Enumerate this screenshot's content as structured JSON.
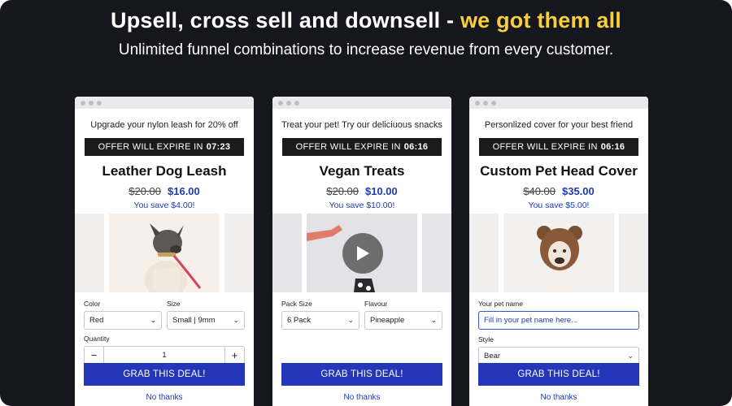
{
  "header": {
    "headline_main": "Upsell, cross sell and downsell - ",
    "headline_highlight": "we got them all",
    "subheadline": "Unlimited funnel combinations to increase revenue from every customer."
  },
  "colors": {
    "background": "#16161e",
    "highlight": "#f7cf3d",
    "cta": "#2337b8",
    "price_blue": "#1f3bb3"
  },
  "cards": [
    {
      "caption": "Upgrade your nylon leash for 20% off",
      "timer_label": "OFFER WILL EXPIRE IN",
      "timer_value": "07:23",
      "product": "Leather Dog Leash",
      "old_price": "$20.00",
      "new_price": "$16.00",
      "savings": "You save $4.00!",
      "image": "dog-with-leash",
      "field1_label": "Color",
      "field1_value": "Red",
      "field2_label": "Size",
      "field2_value": "Small | 9mm",
      "quantity_label": "Quantity",
      "quantity_minus": "−",
      "quantity_value": "1",
      "quantity_plus": "+",
      "cta": "GRAB THIS DEAL!",
      "decline": "No thanks"
    },
    {
      "caption": "Treat your pet! Try our deliciuous snacks",
      "timer_label": "OFFER WILL EXPIRE IN",
      "timer_value": "06:16",
      "product": "Vegan Treats",
      "old_price": "$20.00",
      "new_price": "$10.00",
      "savings": "You save $10.00!",
      "image": "video-with-play-icon",
      "field1_label": "Pack Size",
      "field1_value": "6 Pack",
      "field2_label": "Flavour",
      "field2_value": "Pineapple",
      "cta": "GRAB THIS DEAL!",
      "decline": "No thanks"
    },
    {
      "caption": "Personlized cover for your best friend",
      "timer_label": "OFFER WILL EXPIRE IN",
      "timer_value": "06:16",
      "product": "Custom Pet Head Cover",
      "old_price": "$40.00",
      "new_price": "$35.00",
      "savings": "You save $5.00!",
      "image": "dog-in-bear-hood",
      "pet_name_label": "Your pet name",
      "pet_name_placeholder": "Fill in your pet name here...",
      "style_label": "Style",
      "style_value": "Bear",
      "cta": "GRAB THIS DEAL!",
      "decline": "No thanks"
    }
  ]
}
